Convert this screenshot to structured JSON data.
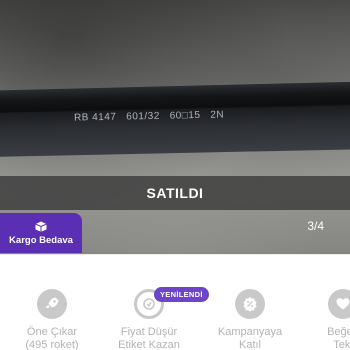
{
  "photo": {
    "engraving": "RB 4147   601/32   60□15   2N",
    "sold_label": "SATILDI",
    "page_counter": "3/4"
  },
  "cargo_badge": {
    "label": "Kargo Bedava",
    "icon": "box-icon"
  },
  "actions": {
    "renewed_badge": "YENİLENDİ",
    "items": [
      {
        "line1": "Öne Çıkar",
        "line2": "(495 roket)",
        "icon": "rocket-icon"
      },
      {
        "line1": "Fiyat Düşür",
        "line2": "Etiket Kazan",
        "icon": "price-tag-icon"
      },
      {
        "line1": "Kampanyaya",
        "line2": "Katıl",
        "icon": "discount-icon"
      },
      {
        "line1": "Beğen",
        "line2": "Tekl",
        "icon": "heart-icon"
      }
    ]
  },
  "colors": {
    "brand_purple": "#5b2fb3",
    "badge_purple": "#6e44c9",
    "icon_gray": "#c9c9c9",
    "label_gray": "#b3b3b3"
  }
}
